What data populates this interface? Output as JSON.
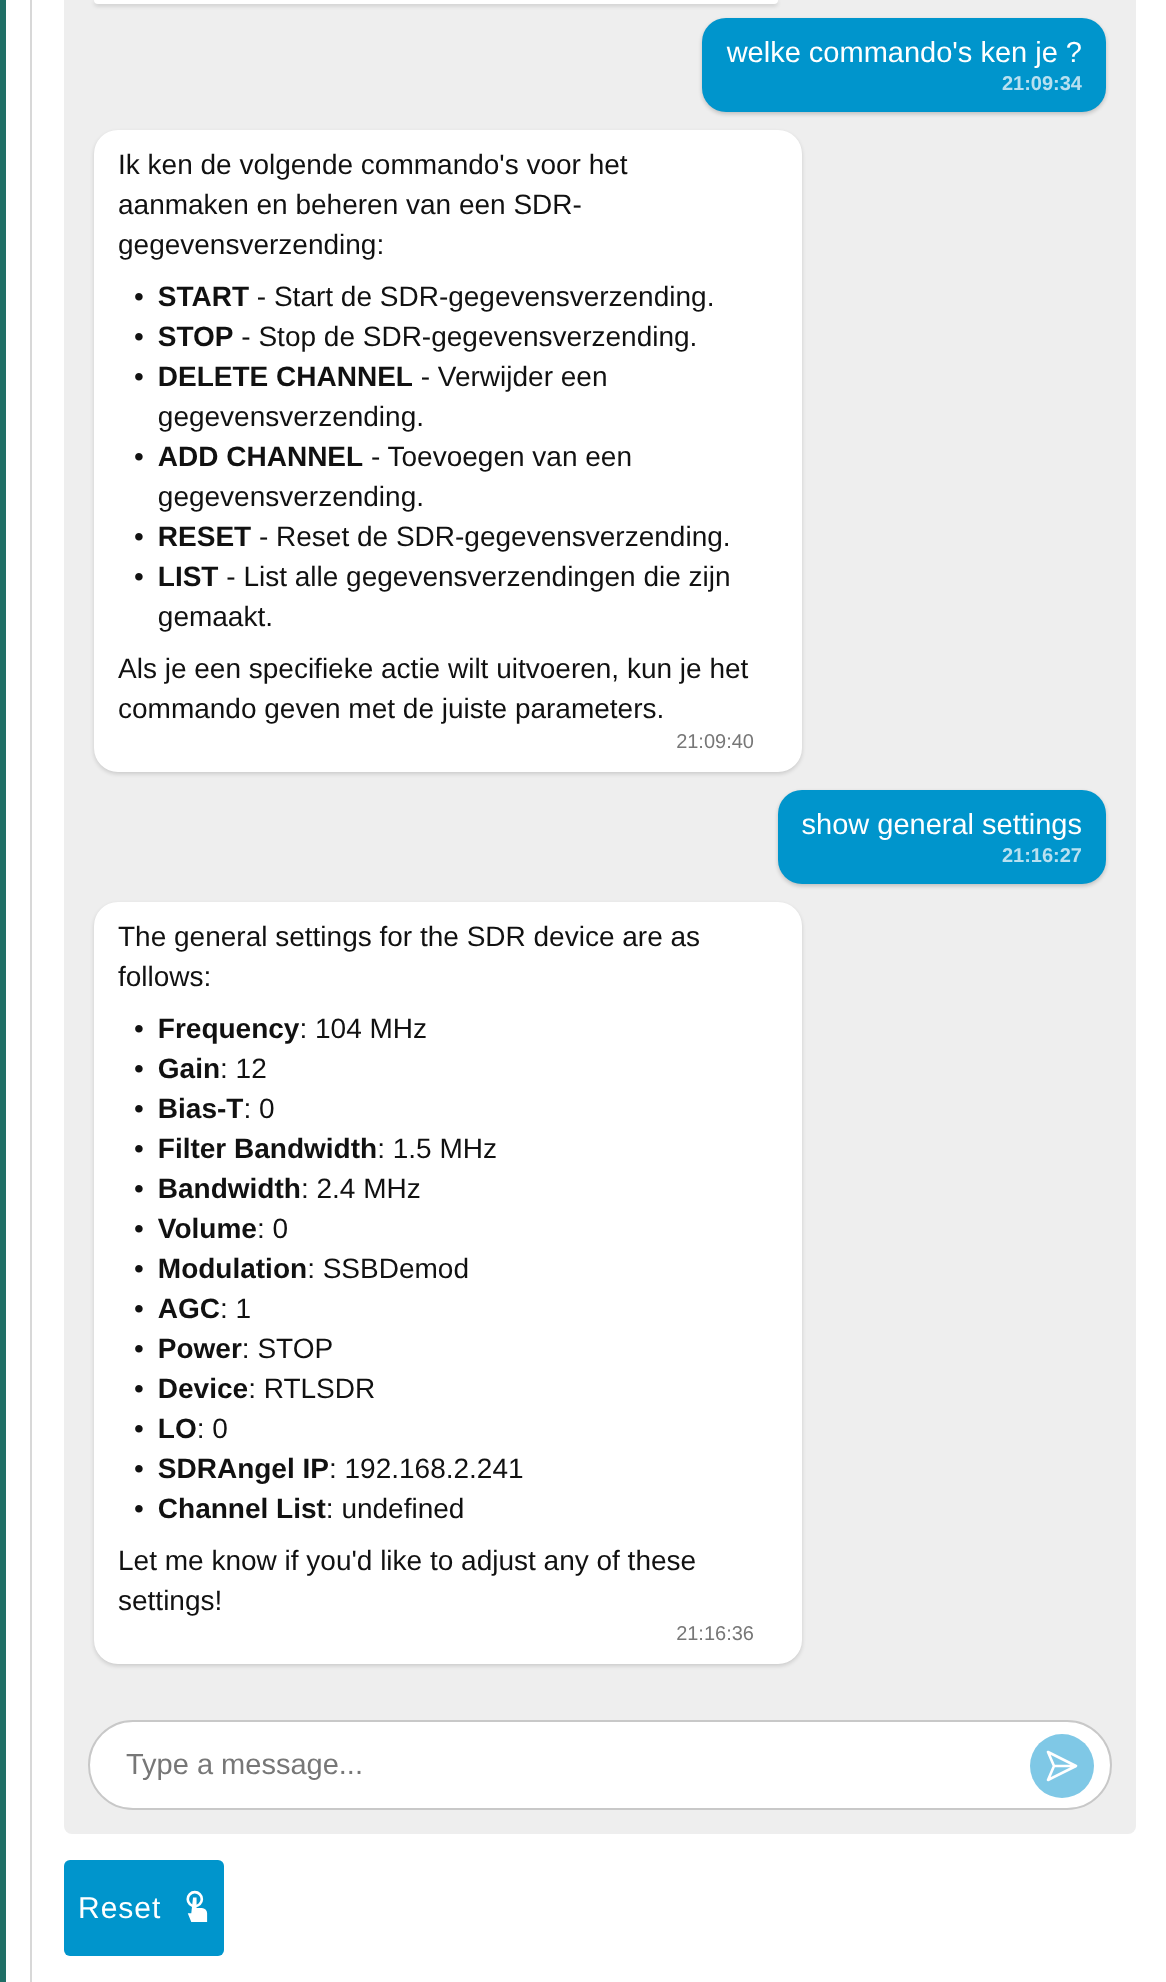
{
  "messages": [
    {
      "kind": "user",
      "text": "welke commando's ken je ?",
      "time": "21:09:34"
    },
    {
      "kind": "bot",
      "intro": "Ik ken de volgende commando's voor het aanmaken en beheren van een SDR-gegevensverzending:",
      "items": [
        {
          "bullet": "•",
          "text": "**START** - Start de SDR-gegevensverzending."
        },
        {
          "bullet": "•",
          "text": "**STOP** - Stop de SDR-gegevensverzending."
        },
        {
          "bullet": "•",
          "text": "**DELETE CHANNEL** - Verwijder een gegevensverzending."
        },
        {
          "bullet": "•",
          "text": "**ADD CHANNEL** - Toevoegen van een gegevensverzending."
        },
        {
          "bullet": "•",
          "text": "**RESET** - Reset de SDR-gegevensverzending."
        },
        {
          "bullet": "•",
          "text": "**LIST** - List alle gegevensverzendingen die zijn gemaakt."
        }
      ],
      "outro": "Als je een specifieke actie wilt uitvoeren, kun je het commando geven met de juiste parameters.",
      "time": "21:09:40"
    },
    {
      "kind": "user",
      "text": "show general settings",
      "time": "21:16:27"
    },
    {
      "kind": "bot",
      "intro": "The general settings for the SDR device are as follows:",
      "items": [
        {
          "bullet": "•",
          "text": "**Frequency**: 104 MHz"
        },
        {
          "bullet": "•",
          "text": "**Gain**: 12"
        },
        {
          "bullet": "•",
          "text": "**Bias-T**: 0"
        },
        {
          "bullet": "•",
          "text": "**Filter Bandwidth**: 1.5 MHz"
        },
        {
          "bullet": "•",
          "text": "**Bandwidth**: 2.4 MHz"
        },
        {
          "bullet": "•",
          "text": "**Volume**: 0"
        },
        {
          "bullet": "•",
          "text": "**Modulation**: SSBDemod"
        },
        {
          "bullet": "•",
          "text": "**AGC**: 1"
        },
        {
          "bullet": "•",
          "text": "**Power**: STOP"
        },
        {
          "bullet": "•",
          "text": "**Device**: RTLSDR"
        },
        {
          "bullet": "•",
          "text": "**LO**: 0"
        },
        {
          "bullet": "•",
          "text": "**SDRAngel IP**: 192.168.2.241"
        },
        {
          "bullet": "•",
          "text": "**Channel List**: undefined"
        }
      ],
      "outro": "Let me know if you'd like to adjust any of these settings!",
      "time": "21:16:36"
    }
  ],
  "input": {
    "placeholder": "Type a message..."
  },
  "reset_button": {
    "label": "Reset"
  }
}
